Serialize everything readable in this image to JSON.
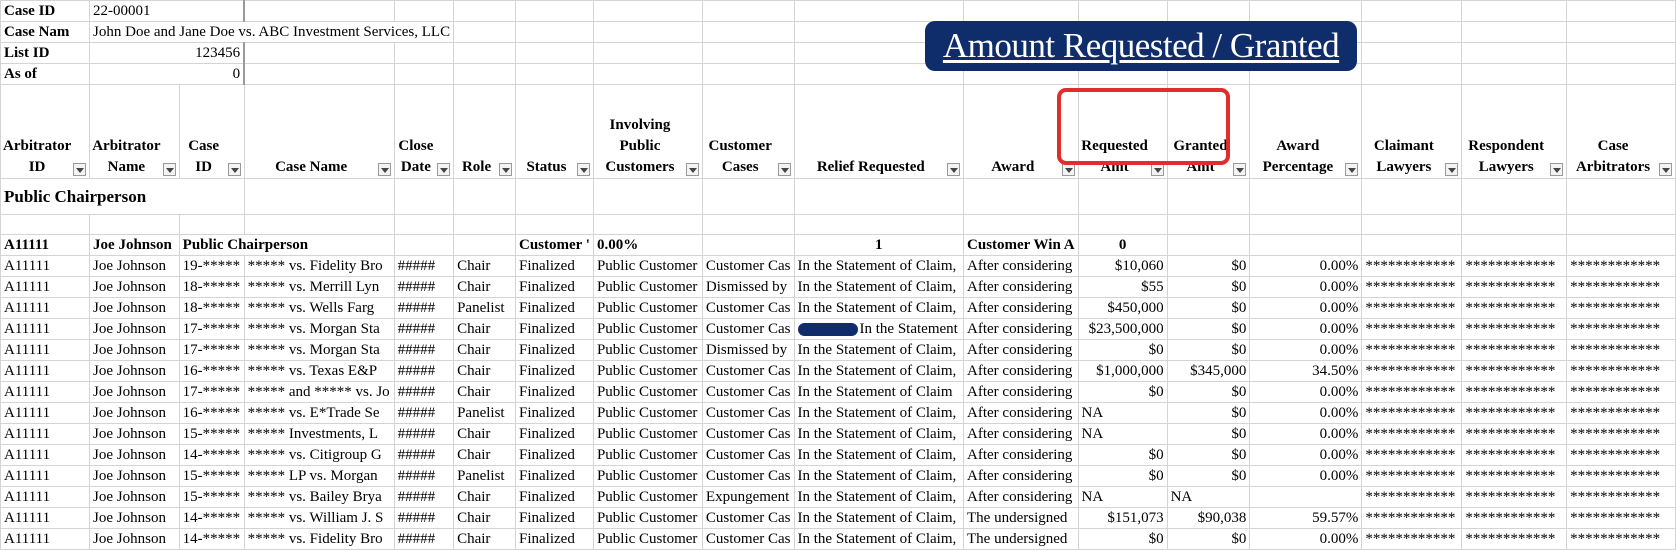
{
  "meta": {
    "case_id_label": "Case ID",
    "case_id_value": "22-00001",
    "case_name_label": "Case Nam",
    "case_name_value": "John Doe and Jane Doe vs. ABC Investment Services, LLC",
    "list_id_label": "List ID",
    "list_id_value": "123456",
    "as_of_label": "As of",
    "as_of_value": "0"
  },
  "banner": {
    "title": "Amount Requested / Granted"
  },
  "headers": {
    "arb_id": "Arbitrator ID",
    "arb_name": "Arbitrator Name",
    "case_id": "Case ID",
    "case_name": "Case Name",
    "close_date": "Close Date",
    "role": "Role",
    "status": "Status",
    "involving": "Involving Public Customers",
    "customer_cases": "Customer Cases",
    "relief": "Relief Requested",
    "award": "Award",
    "requested": "Requested Amt",
    "granted": "Granted Amt",
    "award_pct": "Award Percentage",
    "claimant": "Claimant Lawyers",
    "respondent": "Respondent Lawyers",
    "case_arb": "Case Arbitrators"
  },
  "section": {
    "title": "Public Chairperson"
  },
  "summary": {
    "arb_id": "A11111",
    "arb_name": "Joe Johnson",
    "case_id": "Public Chairperson",
    "status": "Customer '",
    "involving": "0.00%",
    "relief": "1",
    "award": "Customer Win A",
    "requested": "0"
  },
  "rows": [
    {
      "arb_id": "A11111",
      "arb_name": "Joe Johnson",
      "case_id": "19-*****",
      "case_name": "***** vs. Fidelity Bro",
      "close_date": "#####",
      "role": "Chair",
      "status": "Finalized",
      "involving": "Public Customer",
      "customer_cases": "Customer Cas",
      "relief": "In the Statement of Claim,",
      "award": "After considering",
      "requested": "$10,060",
      "granted": "$0",
      "award_pct": "0.00%",
      "claimant": "************",
      "respondent": "************",
      "case_arb": "************"
    },
    {
      "arb_id": "A11111",
      "arb_name": "Joe Johnson",
      "case_id": "18-*****",
      "case_name": "***** vs. Merrill Lyn",
      "close_date": "#####",
      "role": "Chair",
      "status": "Finalized",
      "involving": "Public Customer",
      "customer_cases": "Dismissed by",
      "relief": "In the Statement of Claim,",
      "award": "After considering",
      "requested": "$55",
      "granted": "$0",
      "award_pct": "0.00%",
      "claimant": "************",
      "respondent": "************",
      "case_arb": "************"
    },
    {
      "arb_id": "A11111",
      "arb_name": "Joe Johnson",
      "case_id": "18-*****",
      "case_name": "***** vs. Wells Farg",
      "close_date": "#####",
      "role": "Panelist",
      "status": "Finalized",
      "involving": "Public Customer",
      "customer_cases": "Customer Cas",
      "relief": "In the Statement of Claim,",
      "award": "After considering",
      "requested": "$450,000",
      "granted": "$0",
      "award_pct": "0.00%",
      "claimant": "************",
      "respondent": "************",
      "case_arb": "************"
    },
    {
      "arb_id": "A11111",
      "arb_name": "Joe Johnson",
      "case_id": "17-*****",
      "case_name": "***** vs. Morgan Sta",
      "close_date": "#####",
      "role": "Chair",
      "status": "Finalized",
      "involving": "Public Customer",
      "customer_cases": "Customer Cas",
      "relief": "In the Statement",
      "relief_redacted": true,
      "award": "After considering",
      "requested": "$23,500,000",
      "granted": "$0",
      "award_pct": "0.00%",
      "claimant": "************",
      "respondent": "************",
      "case_arb": "************"
    },
    {
      "arb_id": "A11111",
      "arb_name": "Joe Johnson",
      "case_id": "17-*****",
      "case_name": "***** vs. Morgan Sta",
      "close_date": "#####",
      "role": "Chair",
      "status": "Finalized",
      "involving": "Public Customer",
      "customer_cases": "Dismissed by",
      "relief": "In the Statement of Claim,",
      "award": "After considering",
      "requested": "$0",
      "granted": "$0",
      "award_pct": "0.00%",
      "claimant": "************",
      "respondent": "************",
      "case_arb": "************"
    },
    {
      "arb_id": "A11111",
      "arb_name": "Joe Johnson",
      "case_id": "16-*****",
      "case_name": "***** vs. Texas E&P",
      "close_date": "#####",
      "role": "Chair",
      "status": "Finalized",
      "involving": "Public Customer",
      "customer_cases": "Customer Cas",
      "relief": "In the Statement of Claim,",
      "award": "After considering",
      "requested": "$1,000,000",
      "granted": "$345,000",
      "award_pct": "34.50%",
      "claimant": "************",
      "respondent": "************",
      "case_arb": "************"
    },
    {
      "arb_id": "A11111",
      "arb_name": "Joe Johnson",
      "case_id": "17-*****",
      "case_name": "***** and ***** vs. Jo",
      "close_date": "#####",
      "role": "Chair",
      "status": "Finalized",
      "involving": "Public Customer",
      "customer_cases": "Customer Cas",
      "relief": "In the Statement of Claim",
      "award": "After considering",
      "requested": "$0",
      "granted": "$0",
      "award_pct": "0.00%",
      "claimant": "************",
      "respondent": "************",
      "case_arb": "************"
    },
    {
      "arb_id": "A11111",
      "arb_name": "Joe Johnson",
      "case_id": "16-*****",
      "case_name": "***** vs. E*Trade Se",
      "close_date": "#####",
      "role": "Panelist",
      "status": "Finalized",
      "involving": "Public Customer",
      "customer_cases": "Customer Cas",
      "relief": "In the Statement of Claim,",
      "award": "After considering",
      "requested": "NA",
      "requested_left": true,
      "granted": "$0",
      "award_pct": "0.00%",
      "claimant": "************",
      "respondent": "************",
      "case_arb": "************"
    },
    {
      "arb_id": "A11111",
      "arb_name": "Joe Johnson",
      "case_id": "15-*****",
      "case_name": "***** Investments, L",
      "close_date": "#####",
      "role": "Chair",
      "status": "Finalized",
      "involving": "Public Customer",
      "customer_cases": "Customer Cas",
      "relief": "In the Statement of Claim,",
      "award": "After considering",
      "requested": "NA",
      "requested_left": true,
      "granted": "$0",
      "award_pct": "0.00%",
      "claimant": "************",
      "respondent": "************",
      "case_arb": "************"
    },
    {
      "arb_id": "A11111",
      "arb_name": "Joe Johnson",
      "case_id": "14-*****",
      "case_name": "***** vs. Citigroup G",
      "close_date": "#####",
      "role": "Chair",
      "status": "Finalized",
      "involving": "Public Customer",
      "customer_cases": "Customer Cas",
      "relief": "In the Statement of Claim,",
      "award": "After considering",
      "requested": "$0",
      "granted": "$0",
      "award_pct": "0.00%",
      "claimant": "************",
      "respondent": "************",
      "case_arb": "************"
    },
    {
      "arb_id": "A11111",
      "arb_name": "Joe Johnson",
      "case_id": "15-*****",
      "case_name": "***** LP vs. Morgan",
      "close_date": "#####",
      "role": "Panelist",
      "status": "Finalized",
      "involving": "Public Customer",
      "customer_cases": "Customer Cas",
      "relief": "In the Statement of Claim,",
      "award": "After considering",
      "requested": "$0",
      "granted": "$0",
      "award_pct": "0.00%",
      "claimant": "************",
      "respondent": "************",
      "case_arb": "************"
    },
    {
      "arb_id": "A11111",
      "arb_name": "Joe Johnson",
      "case_id": "15-*****",
      "case_name": "***** vs. Bailey Brya",
      "close_date": "#####",
      "role": "Chair",
      "status": "Finalized",
      "involving": "Public Customer",
      "customer_cases": "Expungement",
      "relief": "In the Statement of Claim,",
      "award": "After considering",
      "requested": "NA",
      "requested_left": true,
      "granted": "NA",
      "granted_left": true,
      "award_pct": "",
      "claimant": "************",
      "respondent": "************",
      "case_arb": "************"
    },
    {
      "arb_id": "A11111",
      "arb_name": "Joe Johnson",
      "case_id": "14-*****",
      "case_name": "***** vs. William J. S",
      "close_date": "#####",
      "role": "Chair",
      "status": "Finalized",
      "involving": "Public Customer",
      "customer_cases": "Customer Cas",
      "relief": "In the Statement of Claim,",
      "award": "The undersigned",
      "requested": "$151,073",
      "granted": "$90,038",
      "award_pct": "59.57%",
      "claimant": "************",
      "respondent": "************",
      "case_arb": "************"
    },
    {
      "arb_id": "A11111",
      "arb_name": "Joe Johnson",
      "case_id": "14-*****",
      "case_name": "***** vs. Fidelity Bro",
      "close_date": "#####",
      "role": "Chair",
      "status": "Finalized",
      "involving": "Public Customer",
      "customer_cases": "Customer Cas",
      "relief": "In the Statement of Claim,",
      "award": "The undersigned",
      "requested": "$0",
      "granted": "$0",
      "award_pct": "0.00%",
      "claimant": "************",
      "respondent": "************",
      "case_arb": "************"
    }
  ],
  "colors": {
    "banner_bg": "#0f2d6b",
    "banner_text": "#ffffff",
    "highlight": "#e32d2d",
    "grid": "#d4d4d4"
  }
}
